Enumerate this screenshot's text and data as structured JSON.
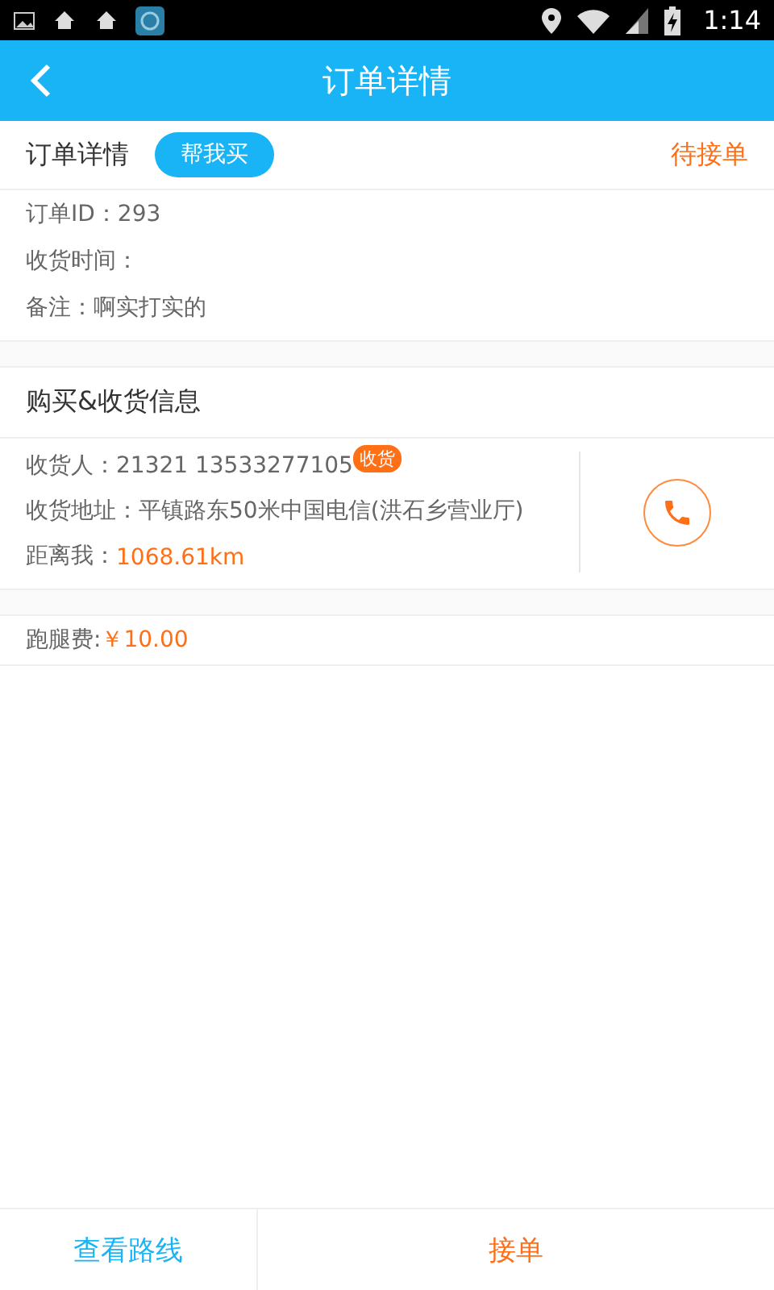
{
  "status_bar": {
    "time": "1:14"
  },
  "header": {
    "title": "订单详情"
  },
  "order": {
    "title": "订单详情",
    "tag": "帮我买",
    "status": "待接单",
    "lines": [
      "订单ID：293",
      "收货时间：",
      "备注：啊实打实的"
    ]
  },
  "delivery": {
    "title": "购买&收货信息",
    "receiver_label": "收货人：",
    "receiver": "21321 13533277105",
    "badge": "收货",
    "address": "收货地址：平镇路东50米中国电信(洪石乡营业厅)",
    "distance_label": "距离我：",
    "distance": "1068.61km"
  },
  "fee": {
    "label": "跑腿费:",
    "amount": "￥10.00"
  },
  "bottom_bar": {
    "buttons": [
      {
        "label": "查看路线",
        "kind": "route"
      },
      {
        "label": "接单",
        "kind": "accept"
      }
    ]
  }
}
